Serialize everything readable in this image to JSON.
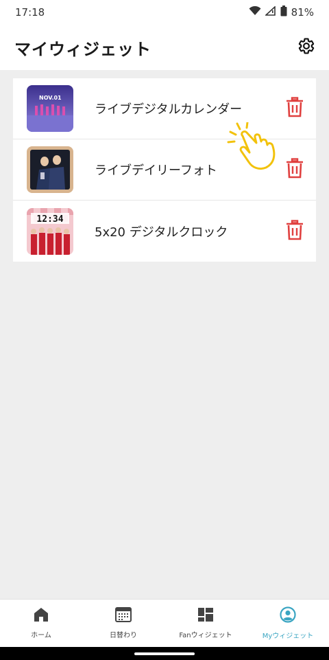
{
  "status_bar": {
    "time": "17:18",
    "battery": "81%"
  },
  "header": {
    "title": "マイウィジェット"
  },
  "widgets": [
    {
      "name": "ライブデジタルカレンダー",
      "thumb_text": "NOV.01"
    },
    {
      "name": "ライブデイリーフォト"
    },
    {
      "name": "5x20 デジタルクロック",
      "thumb_text": "12:34"
    }
  ],
  "bottom_nav": [
    {
      "label": "ホーム",
      "icon": "home-icon"
    },
    {
      "label": "日替わり",
      "icon": "calendar-icon"
    },
    {
      "label": "Fanウィジェット",
      "icon": "widgets-icon"
    },
    {
      "label": "Myウィジェット",
      "icon": "account-circle-icon"
    }
  ],
  "colors": {
    "accent": "#3aa5c2",
    "delete": "#e0403f",
    "pointer": "#f2c20c"
  }
}
